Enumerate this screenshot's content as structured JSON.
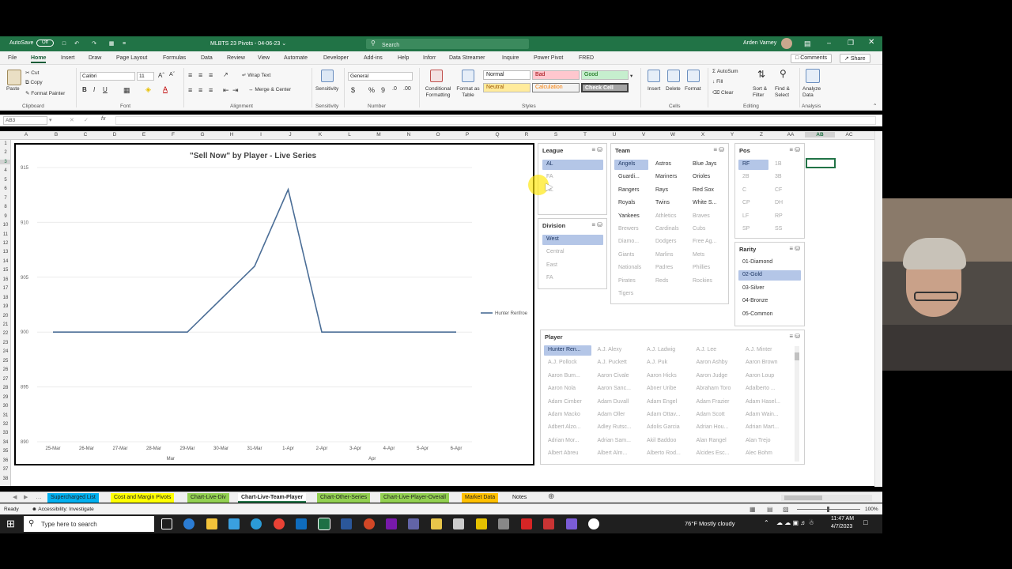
{
  "window": {
    "title": "MLBTS 23 Pivots - 04-06-23 ⌄",
    "autosave": "AutoSave",
    "autosave_state": "Off",
    "search_placeholder": "Search",
    "user": "Arden Varney"
  },
  "menu": [
    "File",
    "Home",
    "Insert",
    "Draw",
    "Page Layout",
    "Formulas",
    "Data",
    "Review",
    "View",
    "Automate",
    "Developer",
    "Add-ins",
    "Help",
    "Inforr",
    "Data Streamer",
    "Inquire",
    "Power Pivot",
    "FRED"
  ],
  "menu_active": "Home",
  "top_buttons": {
    "comments": "Comments",
    "share": "Share"
  },
  "ribbon": {
    "paste": "Paste",
    "cut": "Cut",
    "copy": "Copy",
    "format_painter": "Format Painter",
    "font_name": "Calibri",
    "font_size": "11",
    "wrap_text": "Wrap Text",
    "merge_center": "Merge & Center",
    "sensitivity": "Sensitivity",
    "number_format": "General",
    "cond_format": "Conditional Formatting",
    "format_table": "Format as Table",
    "styles": {
      "normal": "Normal",
      "bad": "Bad",
      "good": "Good",
      "neutral": "Neutral",
      "calculation": "Calculation",
      "check_cell": "Check Cell"
    },
    "insert": "Insert",
    "delete": "Delete",
    "format": "Format",
    "autosum": "AutoSum",
    "fill": "Fill",
    "clear": "Clear",
    "sort_filter": "Sort & Filter",
    "find_select": "Find & Select",
    "analyze": "Analyze Data",
    "groups": [
      "Clipboard",
      "Font",
      "Alignment",
      "Sensitivity",
      "Number",
      "Styles",
      "Cells",
      "Editing",
      "Analysis"
    ]
  },
  "formula_bar": {
    "name_box": "AB3",
    "fx": "fx",
    "value": ""
  },
  "columns": [
    "A",
    "B",
    "C",
    "D",
    "E",
    "F",
    "G",
    "H",
    "I",
    "J",
    "K",
    "L",
    "M",
    "N",
    "O",
    "P",
    "Q",
    "R",
    "S",
    "T",
    "U",
    "V",
    "W",
    "X",
    "Y",
    "Z",
    "AA",
    "AB",
    "AC"
  ],
  "rows": [
    "1",
    "2",
    "3",
    "4",
    "5",
    "6",
    "7",
    "8",
    "9",
    "10",
    "11",
    "12",
    "13",
    "14",
    "15",
    "16",
    "17",
    "18",
    "19",
    "20",
    "21",
    "22",
    "23",
    "24",
    "25",
    "26",
    "27",
    "28",
    "29",
    "30",
    "31",
    "32",
    "33",
    "34",
    "35",
    "36",
    "37",
    "38"
  ],
  "chart_data": {
    "type": "line",
    "title": "\"Sell Now\" by Player - Live Series",
    "categories": [
      "25-Mar",
      "26-Mar",
      "27-Mar",
      "28-Mar",
      "29-Mar",
      "30-Mar",
      "31-Mar",
      "1-Apr",
      "2-Apr",
      "3-Apr",
      "4-Apr",
      "5-Apr",
      "6-Apr"
    ],
    "month_labels": [
      "Mar",
      "Apr"
    ],
    "series": [
      {
        "name": "Hunter Renfroe",
        "values": [
          900,
          900,
          900,
          900,
          900,
          903,
          906,
          913,
          900,
          900,
          900,
          900,
          900
        ],
        "color": "#4a6d96"
      }
    ],
    "ylim": [
      890,
      915
    ],
    "yticks": [
      890,
      895,
      900,
      905,
      910,
      915
    ],
    "legend": "right",
    "grid": true
  },
  "slicers": {
    "league": {
      "title": "League",
      "items": [
        {
          "label": "AL",
          "state": "sel"
        },
        {
          "label": "FA",
          "state": "off"
        },
        {
          "label": "NL",
          "state": "off"
        }
      ]
    },
    "division": {
      "title": "Division",
      "items": [
        {
          "label": "West",
          "state": "sel"
        },
        {
          "label": "Central",
          "state": "off"
        },
        {
          "label": "East",
          "state": "off"
        },
        {
          "label": "FA",
          "state": "off"
        }
      ]
    },
    "team": {
      "title": "Team",
      "items": [
        {
          "label": "Angels",
          "state": "sel"
        },
        {
          "label": "Astros",
          "state": "on"
        },
        {
          "label": "Blue Jays",
          "state": "on"
        },
        {
          "label": "Guardi...",
          "state": "on"
        },
        {
          "label": "Mariners",
          "state": "on"
        },
        {
          "label": "Orioles",
          "state": "on"
        },
        {
          "label": "Rangers",
          "state": "on"
        },
        {
          "label": "Rays",
          "state": "on"
        },
        {
          "label": "Red Sox",
          "state": "on"
        },
        {
          "label": "Royals",
          "state": "on"
        },
        {
          "label": "Twins",
          "state": "on"
        },
        {
          "label": "White S...",
          "state": "on"
        },
        {
          "label": "Yankees",
          "state": "on"
        },
        {
          "label": "Athletics",
          "state": "off"
        },
        {
          "label": "Braves",
          "state": "off"
        },
        {
          "label": "Brewers",
          "state": "off"
        },
        {
          "label": "Cardinals",
          "state": "off"
        },
        {
          "label": "Cubs",
          "state": "off"
        },
        {
          "label": "Diamo...",
          "state": "off"
        },
        {
          "label": "Dodgers",
          "state": "off"
        },
        {
          "label": "Free Ag...",
          "state": "off"
        },
        {
          "label": "Giants",
          "state": "off"
        },
        {
          "label": "Marlins",
          "state": "off"
        },
        {
          "label": "Mets",
          "state": "off"
        },
        {
          "label": "Nationals",
          "state": "off"
        },
        {
          "label": "Padres",
          "state": "off"
        },
        {
          "label": "Phillies",
          "state": "off"
        },
        {
          "label": "Pirates",
          "state": "off"
        },
        {
          "label": "Reds",
          "state": "off"
        },
        {
          "label": "Rockies",
          "state": "off"
        },
        {
          "label": "Tigers",
          "state": "off"
        }
      ]
    },
    "pos": {
      "title": "Pos",
      "items": [
        {
          "label": "RF",
          "state": "sel"
        },
        {
          "label": "1B",
          "state": "off"
        },
        {
          "label": "2B",
          "state": "off"
        },
        {
          "label": "3B",
          "state": "off"
        },
        {
          "label": "C",
          "state": "off"
        },
        {
          "label": "CF",
          "state": "off"
        },
        {
          "label": "CP",
          "state": "off"
        },
        {
          "label": "DH",
          "state": "off"
        },
        {
          "label": "LF",
          "state": "off"
        },
        {
          "label": "RP",
          "state": "off"
        },
        {
          "label": "SP",
          "state": "off"
        },
        {
          "label": "SS",
          "state": "off"
        }
      ]
    },
    "rarity": {
      "title": "Rarity",
      "items": [
        {
          "label": "01-Diamond",
          "state": "on"
        },
        {
          "label": "02-Gold",
          "state": "sel"
        },
        {
          "label": "03-Silver",
          "state": "on"
        },
        {
          "label": "04-Bronze",
          "state": "on"
        },
        {
          "label": "05-Common",
          "state": "on"
        }
      ]
    },
    "player": {
      "title": "Player",
      "items": [
        {
          "label": "Hunter Ren...",
          "state": "sel"
        },
        {
          "label": "A.J. Alexy",
          "state": "off"
        },
        {
          "label": "A.J. Ladwig",
          "state": "off"
        },
        {
          "label": "A.J. Lee",
          "state": "off"
        },
        {
          "label": "A.J. Minter",
          "state": "off"
        },
        {
          "label": "A.J. Pollock",
          "state": "off"
        },
        {
          "label": "A.J. Puckett",
          "state": "off"
        },
        {
          "label": "A.J. Puk",
          "state": "off"
        },
        {
          "label": "Aaron Ashby",
          "state": "off"
        },
        {
          "label": "Aaron Brown",
          "state": "off"
        },
        {
          "label": "Aaron Bum...",
          "state": "off"
        },
        {
          "label": "Aaron Civale",
          "state": "off"
        },
        {
          "label": "Aaron Hicks",
          "state": "off"
        },
        {
          "label": "Aaron Judge",
          "state": "off"
        },
        {
          "label": "Aaron Loup",
          "state": "off"
        },
        {
          "label": "Aaron Nola",
          "state": "off"
        },
        {
          "label": "Aaron Sanc...",
          "state": "off"
        },
        {
          "label": "Abner Uribe",
          "state": "off"
        },
        {
          "label": "Abraham Toro",
          "state": "off"
        },
        {
          "label": "Adalberto ...",
          "state": "off"
        },
        {
          "label": "Adam Cimber",
          "state": "off"
        },
        {
          "label": "Adam Duvall",
          "state": "off"
        },
        {
          "label": "Adam Engel",
          "state": "off"
        },
        {
          "label": "Adam Frazier",
          "state": "off"
        },
        {
          "label": "Adam Hasel...",
          "state": "off"
        },
        {
          "label": "Adam Macko",
          "state": "off"
        },
        {
          "label": "Adam Oller",
          "state": "off"
        },
        {
          "label": "Adam Ottav...",
          "state": "off"
        },
        {
          "label": "Adam Scott",
          "state": "off"
        },
        {
          "label": "Adam Wain...",
          "state": "off"
        },
        {
          "label": "Adbert Alzo...",
          "state": "off"
        },
        {
          "label": "Adley Rutsc...",
          "state": "off"
        },
        {
          "label": "Adolis Garcia",
          "state": "off"
        },
        {
          "label": "Adrian Hou...",
          "state": "off"
        },
        {
          "label": "Adrian Mart...",
          "state": "off"
        },
        {
          "label": "Adrian Mor...",
          "state": "off"
        },
        {
          "label": "Adrian Sam...",
          "state": "off"
        },
        {
          "label": "Akil Baddoo",
          "state": "off"
        },
        {
          "label": "Alan Rangel",
          "state": "off"
        },
        {
          "label": "Alan Trejo",
          "state": "off"
        },
        {
          "label": "Albert Abreu",
          "state": "off"
        },
        {
          "label": "Albert Alm...",
          "state": "off"
        },
        {
          "label": "Alberto Rod...",
          "state": "off"
        },
        {
          "label": "Alcides Esc...",
          "state": "off"
        },
        {
          "label": "Alec Bohm",
          "state": "off"
        }
      ]
    }
  },
  "sheet_tabs": [
    {
      "label": "Supercharged List",
      "color": "#00b0f0"
    },
    {
      "label": "Cost and Margin Pivots",
      "color": "#ffff00"
    },
    {
      "label": "Chart-Live-Div",
      "color": "#92d050"
    },
    {
      "label": "Chart-Live-Team-Player",
      "color": "#ffffff"
    },
    {
      "label": "Chart-Other-Series",
      "color": "#92d050"
    },
    {
      "label": "Chart-Live-Player-Overall",
      "color": "#92d050"
    },
    {
      "label": "Market Data",
      "color": "#ffc000"
    },
    {
      "label": "Notes",
      "color": "#f0f0f0"
    }
  ],
  "status": {
    "ready": "Ready",
    "accessibility": "Accessibility: Investigate",
    "zoom": "100%"
  },
  "taskbar": {
    "search_placeholder": "Type here to search",
    "weather": "76°F  Mostly cloudy",
    "time": "11:47 AM",
    "date": "4/7/2023"
  }
}
